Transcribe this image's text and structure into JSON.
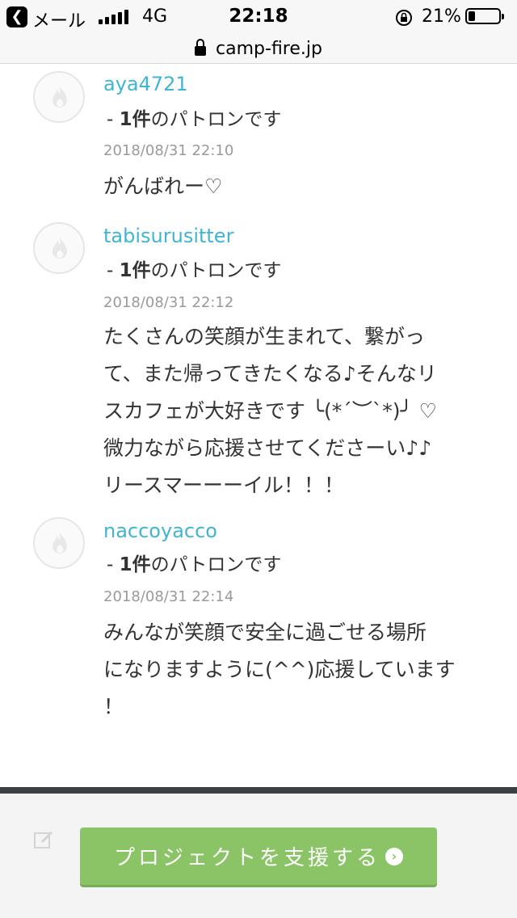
{
  "status_bar": {
    "back_app": "メール",
    "network": "4G",
    "time": "22:18",
    "battery": "21%"
  },
  "url_bar": {
    "domain": "camp-fire.jp"
  },
  "comments": [
    {
      "username": "aya4721",
      "patron_count": "1件",
      "patron_suffix": "のパトロンです",
      "timestamp": "2018/08/31 22:10",
      "message_lines": [
        "がんばれー♡"
      ]
    },
    {
      "username": "tabisurusitter",
      "patron_count": "1件",
      "patron_suffix": "のパトロンです",
      "timestamp": "2018/08/31 22:12",
      "message_lines": [
        "たくさんの笑顔が生まれて、繋がっ",
        "て、また帰ってきたくなる♪そんなリ",
        "スカフェが大好きです ╰(*´︶`*)╯ ♡",
        "微力ながら応援させてくださーい♪♪",
        "リースマーーーイル！！！"
      ]
    },
    {
      "username": "naccoyacco",
      "patron_count": "1件",
      "patron_suffix": "のパトロンです",
      "timestamp": "2018/08/31 22:14",
      "message_lines": [
        "みんなが笑顔で安全に過ごせる場所",
        "になりますように(^^)応援しています",
        "！"
      ]
    }
  ],
  "footer": {
    "cta_label": "プロジェクトを支援する",
    "cta_icon": "chevron-right-circle-icon"
  },
  "colors": {
    "username": "#3fb6d1",
    "cta_bg": "#8bc467",
    "footer_border": "#3c4043"
  }
}
